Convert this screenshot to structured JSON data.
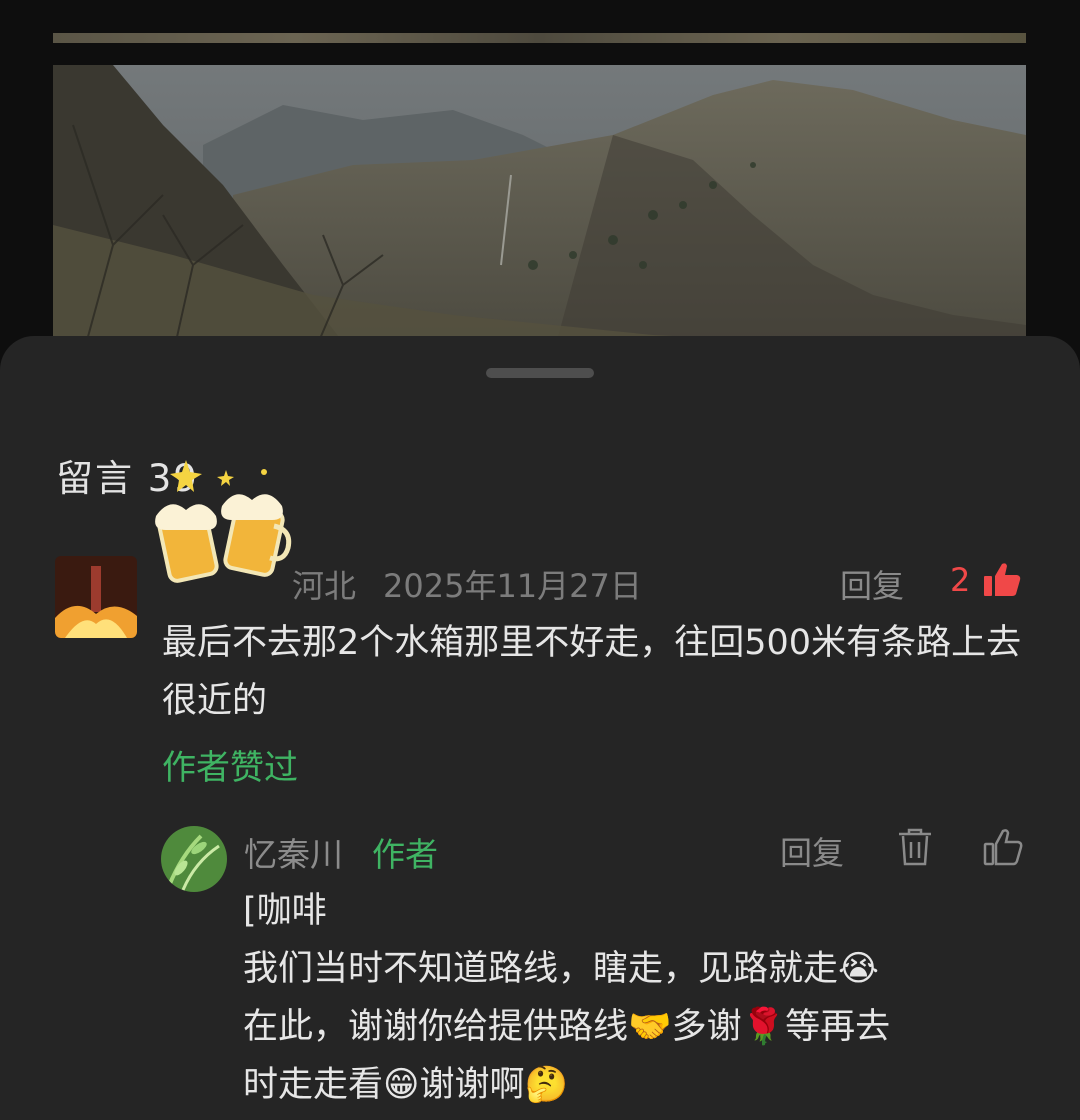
{
  "sheet": {
    "title": "留言 39"
  },
  "comment": {
    "location": "河北",
    "date": "2025年11月27日",
    "reply_label": "回复",
    "like_count": "2",
    "text": "最后不去那2个水箱那里不好走，往回500米有条路上去很近的",
    "author_liked": "作者赞过"
  },
  "reply": {
    "username": "忆秦川",
    "author_tag": "作者",
    "reply_label": "回复",
    "lines": [
      "[咖啡",
      "我们当时不知道路线，瞎走，见路就走😭",
      "在此，谢谢你给提供路线🤝多谢🌹等再去",
      "时走走看😁谢谢啊🤔"
    ]
  },
  "colors": {
    "background": "#0e0e0e",
    "sheet": "#252525",
    "accent_green": "#3fb463",
    "like_red": "#f04848",
    "muted_text": "#7c7c7c",
    "body_text": "#e6e6e6"
  },
  "icons": [
    "cheers-beer-sticker",
    "thumbs-up-filled-icon",
    "trash-icon",
    "thumbs-up-outline-icon"
  ]
}
